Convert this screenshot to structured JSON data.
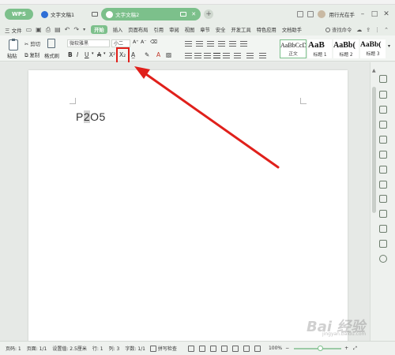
{
  "app": {
    "wps_label": "WPS",
    "tabs": [
      {
        "label": "文字文稿1"
      },
      {
        "label": "文字文稿2"
      }
    ],
    "add_tab": "+",
    "user": "用行光在手"
  },
  "menu": {
    "file": "三 文件",
    "items": [
      "开始",
      "插入",
      "页面布局",
      "引用",
      "审阅",
      "视图",
      "章节",
      "安全",
      "开发工具",
      "特色应用",
      "文档助手"
    ],
    "active": "开始",
    "search": "查找命令"
  },
  "ribbon": {
    "paste": "粘贴",
    "cut": "剪切",
    "copy": "复制",
    "format_painter": "格式刷",
    "font": "微软雅黑",
    "font_size": "小二",
    "bold": "B",
    "italic": "I",
    "underline": "U",
    "strike": "A",
    "superscript": "X²",
    "subscript": "X₂",
    "styles": [
      {
        "sample": "AaBbCcDd",
        "caption": "正文"
      },
      {
        "sample": "AaB",
        "caption": "标题 1"
      },
      {
        "sample": "AaBb(",
        "caption": "标题 2"
      },
      {
        "sample": "AaBb(",
        "caption": "标题 3"
      }
    ]
  },
  "document": {
    "text_before": "P",
    "text_selected": "2",
    "text_after": "O5"
  },
  "status": {
    "page_no": "页码: 1",
    "pages": "页面: 1/1",
    "setting": "设置值: 2.5厘米",
    "row": "行: 1",
    "col": "列: 3",
    "words": "字数: 1/1",
    "spellcheck": "拼写检查",
    "zoom": "100%",
    "zoom_level": 0.55
  },
  "watermark": {
    "main": "Bai 经验",
    "sub": "jingyan.baidu.com"
  },
  "colors": {
    "accent": "#7cc08b",
    "annotation": "#e0201b"
  }
}
